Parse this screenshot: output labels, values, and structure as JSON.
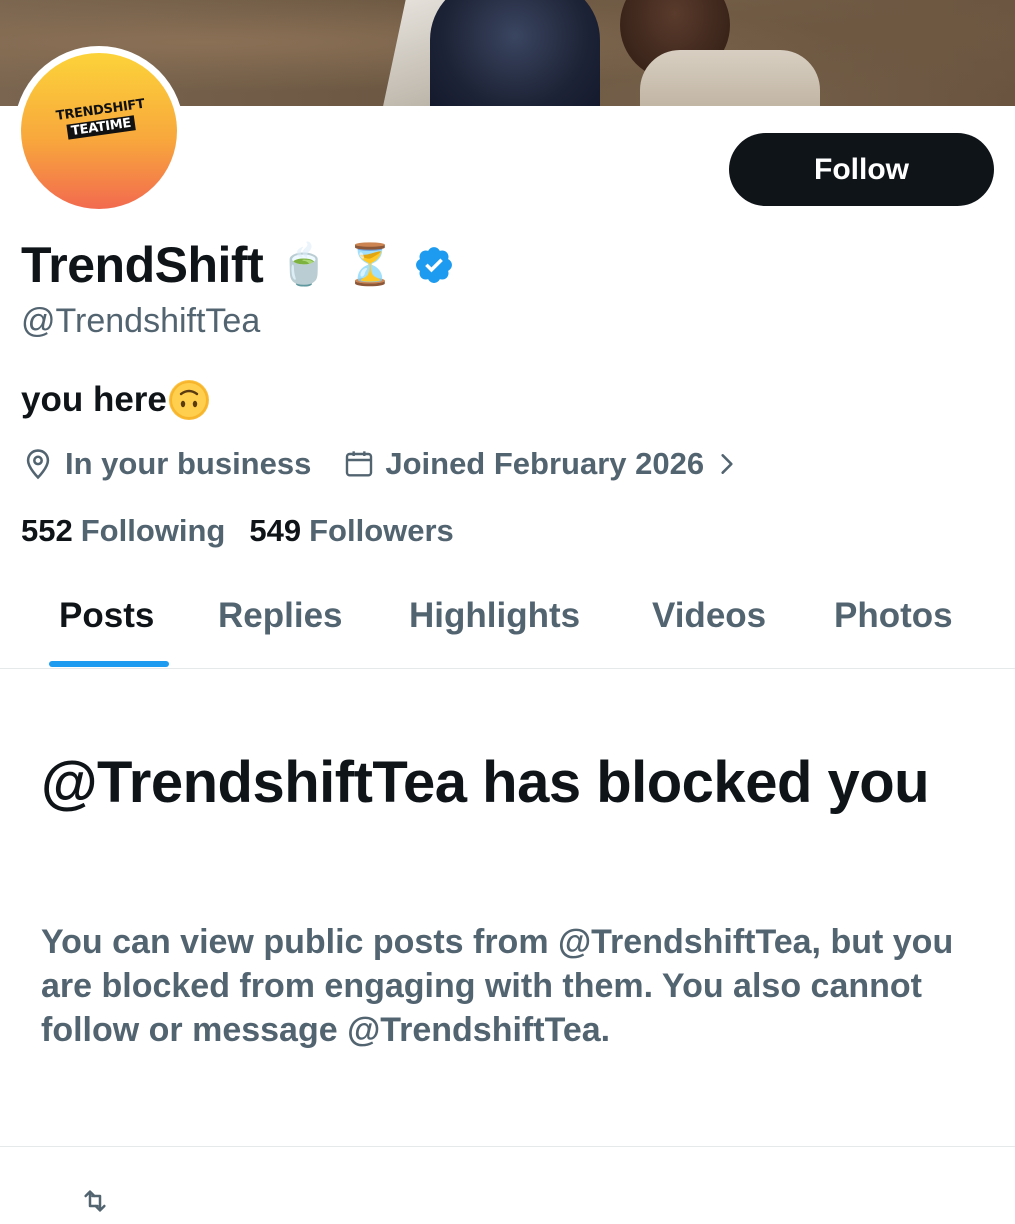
{
  "profile": {
    "display_name": "TrendShift",
    "name_emojis": [
      "🍵",
      "⏳"
    ],
    "handle": "@TrendshiftTea",
    "bio": "you here",
    "bio_emoji": "upside-down-face",
    "location": "In your business",
    "joined": "Joined February 2026",
    "avatar_logo": [
      "TRENDSHIFT",
      "TEATIME"
    ],
    "verified": true,
    "verified_color": "#1d9bf0"
  },
  "actions": {
    "follow_label": "Follow"
  },
  "stats": {
    "following_count": "552",
    "following_label": "Following",
    "followers_count": "549",
    "followers_label": "Followers"
  },
  "tabs": [
    {
      "label": "Posts",
      "active": true
    },
    {
      "label": "Replies",
      "active": false
    },
    {
      "label": "Highlights",
      "active": false
    },
    {
      "label": "Videos",
      "active": false
    },
    {
      "label": "Photos",
      "active": false
    }
  ],
  "blocked": {
    "title": "@TrendshiftTea has blocked you",
    "description": "You can view public posts from @TrendshiftTea, but you are blocked from engaging with them. You also cannot follow or message @TrendshiftTea."
  },
  "icons": {
    "location": "location-pin-icon",
    "calendar": "calendar-icon",
    "chevron": "chevron-right-icon",
    "verified": "verified-badge-icon",
    "repost": "repost-icon"
  },
  "colors": {
    "text_primary": "#0f1419",
    "text_secondary": "#536471",
    "accent": "#1d9bf0",
    "button_bg": "#0f1419"
  }
}
